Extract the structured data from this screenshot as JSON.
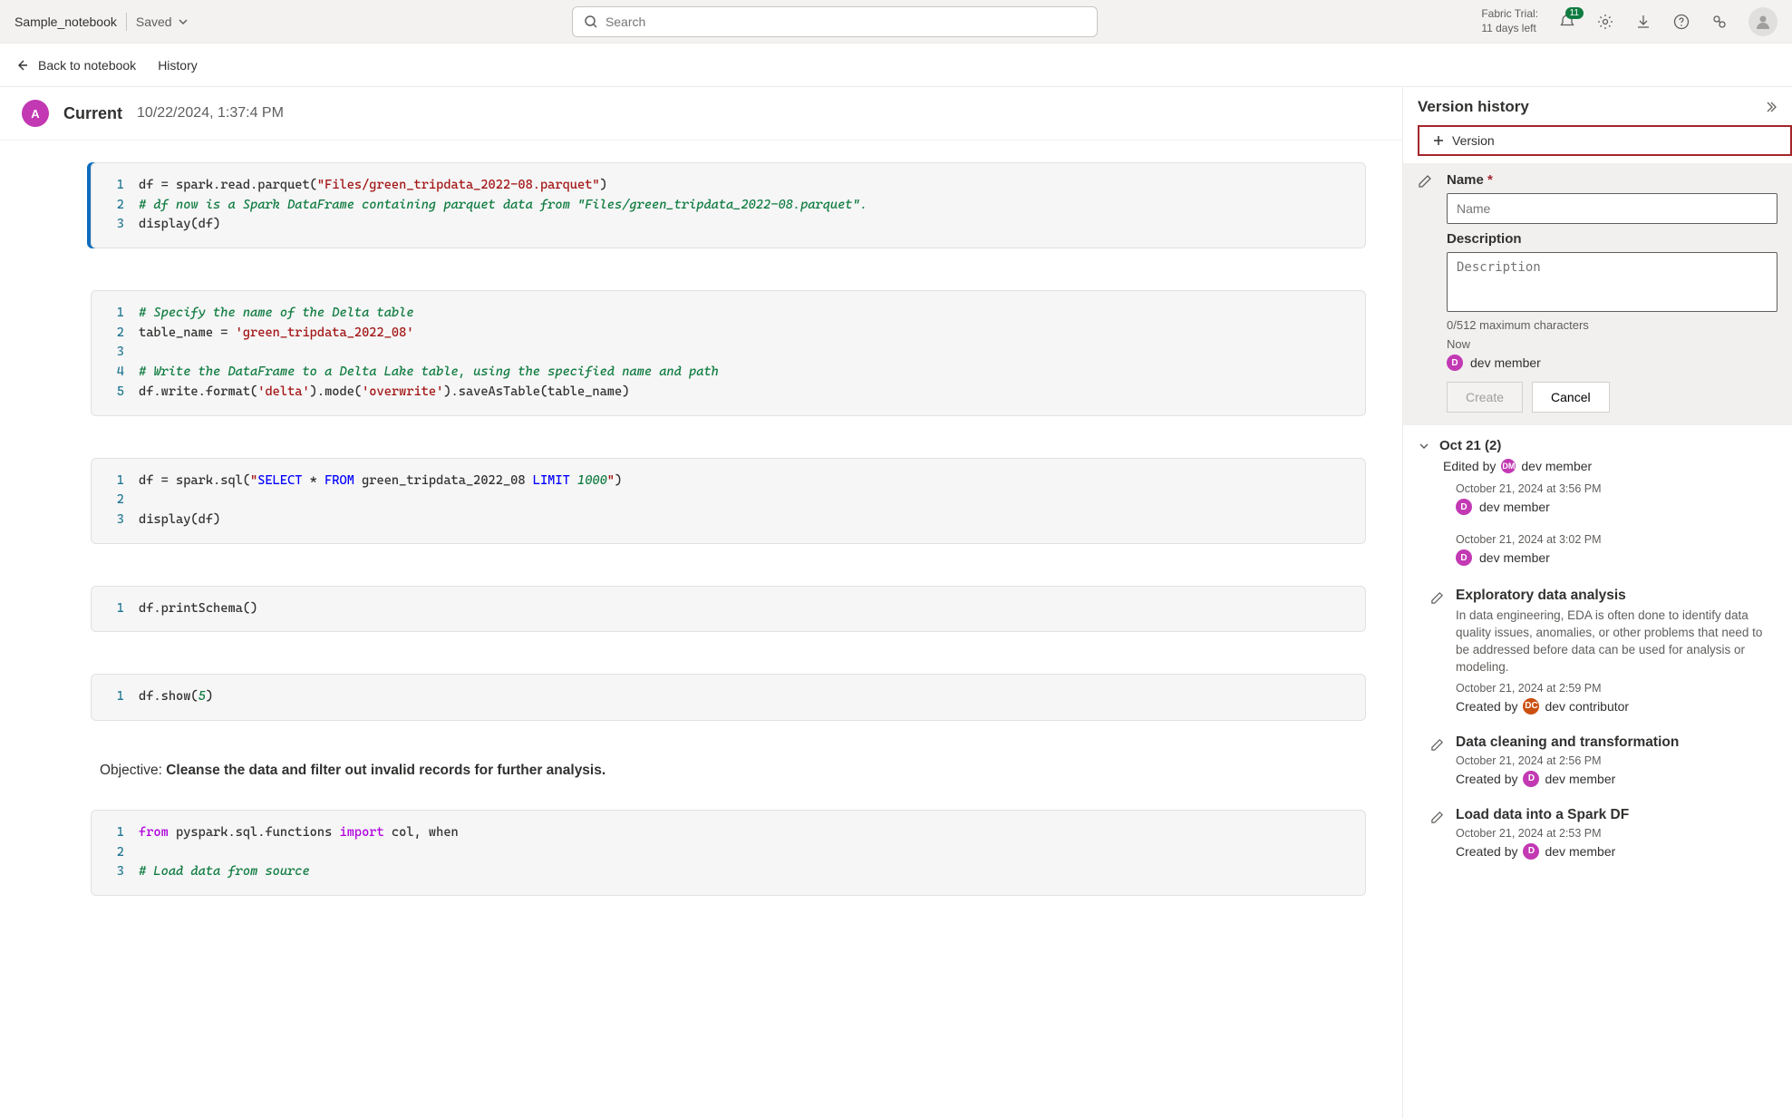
{
  "topbar": {
    "notebook_name": "Sample_notebook",
    "saved": "Saved",
    "search_placeholder": "Search",
    "trial_line1": "Fabric Trial:",
    "trial_line2": "11 days left",
    "notif_badge": "11"
  },
  "subbar": {
    "back": "Back to notebook",
    "history": "History"
  },
  "nb_header": {
    "avatar_initial": "A",
    "current": "Current",
    "timestamp": "10/22/2024, 1:37:4 PM"
  },
  "cells": {
    "c1": {
      "l1a": "df = spark.read.parquet(",
      "l1b": "\"Files/green_tripdata_2022-08.parquet\"",
      "l1c": ")",
      "l2": "# df now is a Spark DataFrame containing parquet data from \"Files/green_tripdata_2022-08.parquet\".",
      "l3": "display(df)"
    },
    "c2": {
      "l1": "# Specify the name of the Delta table",
      "l2a": "table_name = ",
      "l2b": "'green_tripdata_2022_08'",
      "l4": "# Write the DataFrame to a Delta Lake table, using the specified name and path",
      "l5a": "df.write.format(",
      "l5b": "'delta'",
      "l5c": ").mode(",
      "l5d": "'overwrite'",
      "l5e": ").saveAsTable(table_name)"
    },
    "c3": {
      "l1a": "df = spark.sql(",
      "l1b": "\"",
      "l1c": "SELECT",
      "l1d": " * ",
      "l1e": "FROM",
      "l1f": " green_tripdata_2022_08 ",
      "l1g": "LIMIT",
      "l1h": " 1000",
      "l1i": "\"",
      "l1j": ")",
      "l3": "display(df)"
    },
    "c4": {
      "l1": "df.printSchema()"
    },
    "c5": {
      "l1a": "df.show(",
      "l1b": "5",
      "l1c": ")"
    },
    "text": {
      "obj_label": "Objective: ",
      "obj_body": "Cleanse the data and filter out invalid records for further analysis."
    },
    "c6": {
      "l1a": "from",
      "l1b": " pyspark.sql.functions ",
      "l1c": "import",
      "l1d": " col, when",
      "l3": "# Load data from source"
    }
  },
  "panel": {
    "title": "Version history",
    "add_version": "Version",
    "form": {
      "name_label": "Name",
      "name_placeholder": "Name",
      "desc_label": "Description",
      "desc_placeholder": "Description",
      "helper": "0/512 maximum characters",
      "now": "Now",
      "member": "dev member",
      "create": "Create",
      "cancel": "Cancel"
    },
    "group": {
      "title": "Oct 21 (2)",
      "edited_by": "Edited by",
      "editor": "dev member"
    },
    "items": [
      {
        "time": "October 21, 2024 at 3:56 PM",
        "author": "dev member"
      },
      {
        "time": "October 21, 2024 at 3:02 PM",
        "author": "dev member"
      }
    ],
    "named": [
      {
        "title": "Exploratory data analysis",
        "desc": "In data engineering, EDA is often done to identify data quality issues, anomalies, or other problems that need to be addressed before data can be used for analysis or modeling.",
        "time": "October 21, 2024 at 2:59 PM",
        "created_by": "Created by",
        "author": "dev contributor",
        "avatar_color": "orange"
      },
      {
        "title": "Data cleaning and transformation",
        "desc": "",
        "time": "October 21, 2024 at 2:56 PM",
        "created_by": "Created by",
        "author": "dev member",
        "avatar_color": "pink"
      },
      {
        "title": "Load data into a Spark DF",
        "desc": "",
        "time": "October 21, 2024 at 2:53 PM",
        "created_by": "Created by",
        "author": "dev member",
        "avatar_color": "pink"
      }
    ]
  }
}
